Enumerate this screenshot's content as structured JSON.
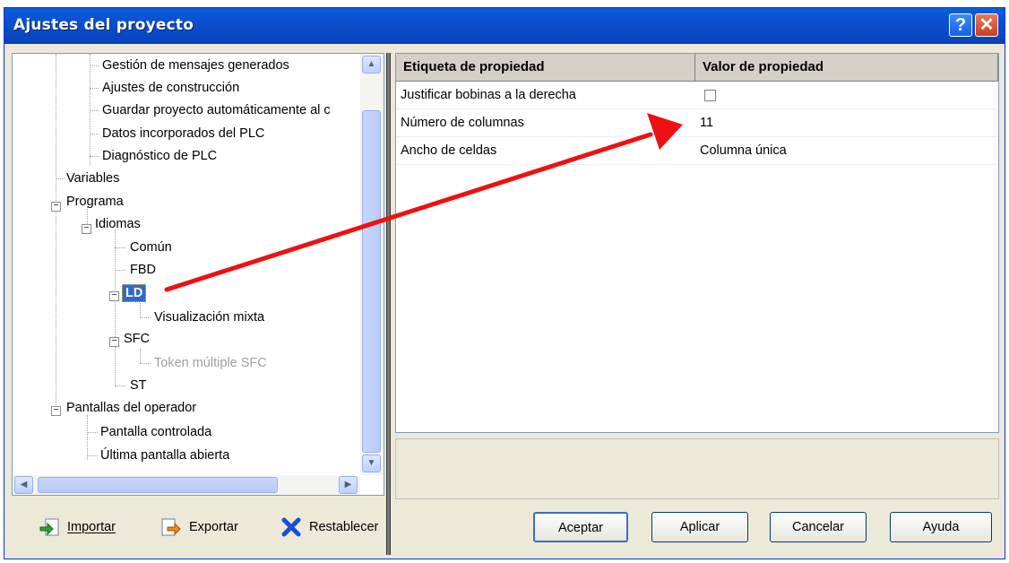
{
  "window": {
    "title": "Ajustes del proyecto",
    "help_btn": "?",
    "close_btn": "✕"
  },
  "tree": {
    "items": [
      "Gestión de mensajes generados",
      "Ajustes de construcción",
      "Guardar proyecto automáticamente al c",
      "Datos incorporados del PLC",
      "Diagnóstico de PLC",
      "Variables",
      "Programa",
      "Idiomas",
      "Común",
      "FBD",
      "LD",
      "Visualización mixta",
      "SFC",
      "Token múltiple SFC",
      "ST",
      "Pantallas del operador",
      "Pantalla controlada",
      "Última pantalla abierta"
    ],
    "selected": "LD",
    "expanded_markers": {
      "minus": "−"
    }
  },
  "grid": {
    "headers": [
      "Etiqueta de propiedad",
      "Valor de propiedad"
    ],
    "rows": [
      {
        "label": "Justificar bobinas a la derecha",
        "value": "",
        "checkbox": true,
        "checked": false
      },
      {
        "label": "Número de columnas",
        "value": "11"
      },
      {
        "label": "Ancho de celdas",
        "value": "Columna única"
      }
    ]
  },
  "toolbar": {
    "import_label": "Importar",
    "export_label": "Exportar",
    "reset_label": "Restablecer"
  },
  "buttons": {
    "accept": "Aceptar",
    "apply": "Aplicar",
    "cancel": "Cancelar",
    "help": "Ayuda"
  },
  "colors": {
    "selection": "#316ac5",
    "arrow": "#ee1111",
    "titlebar": "#0b4fd0"
  }
}
